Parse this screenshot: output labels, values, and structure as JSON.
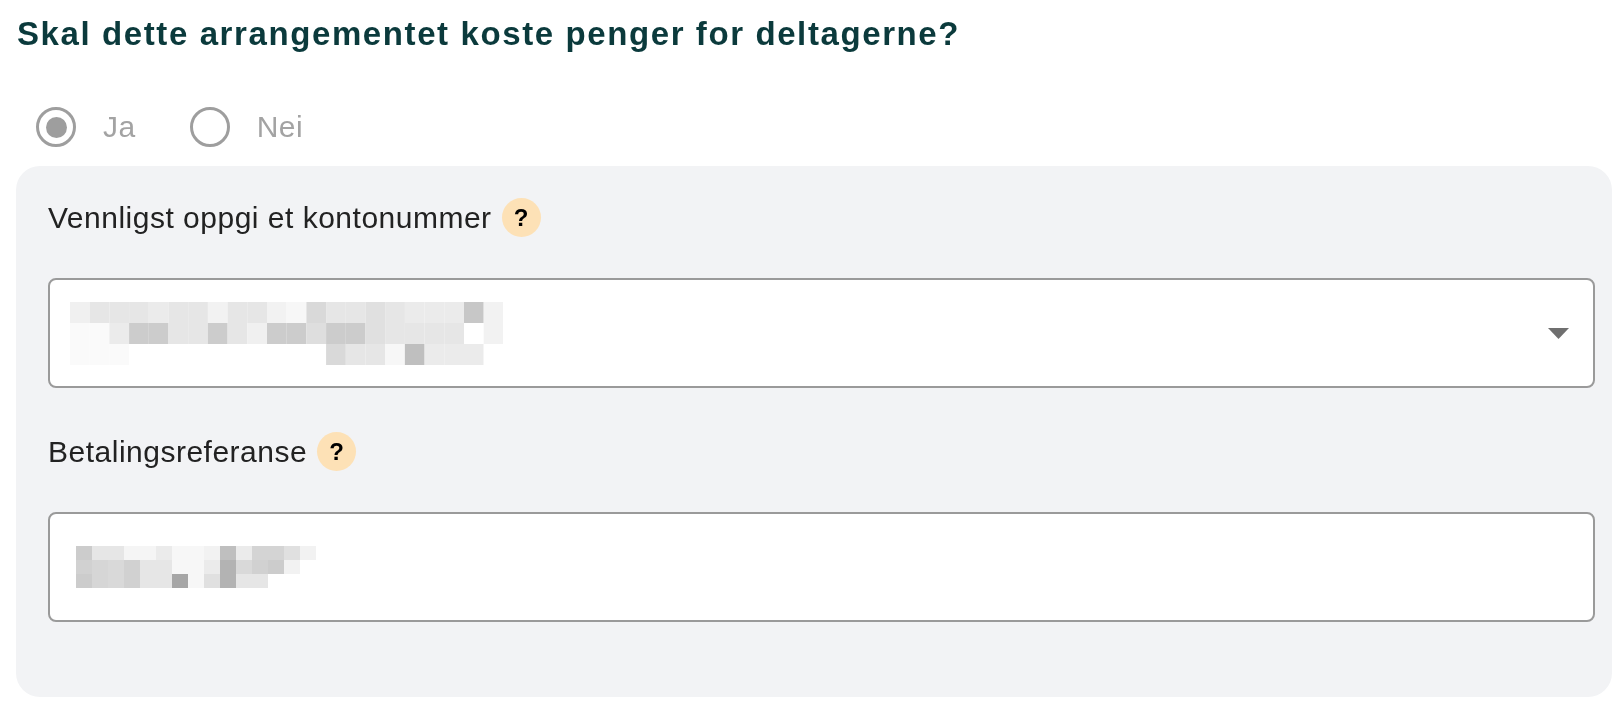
{
  "question": {
    "title": "Skal dette arrangementet koste penger for deltagerne?"
  },
  "choice": {
    "disabled": true,
    "options": [
      {
        "label": "Ja",
        "selected": true
      },
      {
        "label": "Nei",
        "selected": false
      }
    ]
  },
  "fields": [
    {
      "kind": "select",
      "label": "Vennligst oppgi et kontonummer",
      "help": "?",
      "redacted": true
    },
    {
      "kind": "text",
      "label": "Betalingsreferanse",
      "help": "?",
      "redacted": true
    }
  ]
}
